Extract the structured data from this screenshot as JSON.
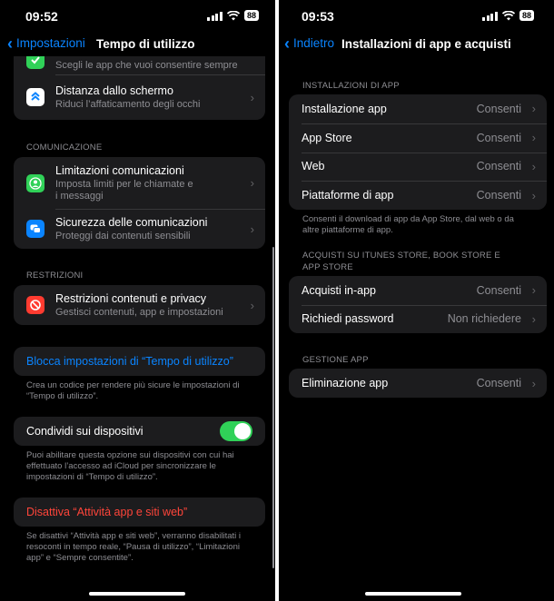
{
  "left": {
    "status": {
      "time": "09:52",
      "battery": "88"
    },
    "nav": {
      "back_label": "Impostazioni",
      "title": "Tempo di utilizzo"
    },
    "partial_row": {
      "sub": "Scegli le app che vuoi consentire sempre"
    },
    "distance": {
      "title": "Distanza dallo schermo",
      "sub": "Riduci l’affaticamento degli occhi"
    },
    "comm_header": "COMUNICAZIONE",
    "comm_limits": {
      "title": "Limitazioni comunicazioni",
      "sub1": "Imposta limiti per le chiamate e",
      "sub2": "i messaggi"
    },
    "comm_safety": {
      "title": "Sicurezza delle comunicazioni",
      "sub": "Proteggi dai contenuti sensibili"
    },
    "restr_header": "RESTRIZIONI",
    "restr": {
      "title": "Restrizioni contenuti e privacy",
      "sub": "Gestisci contenuti, app e impostazioni"
    },
    "lock_settings": "Blocca impostazioni di “Tempo di utilizzo”",
    "lock_note": [
      "Crea un codice per rendere più sicure le impostazioni di",
      "“Tempo di utilizzo”."
    ],
    "share_devices": "Condividi sui dispositivi",
    "share_note": [
      "Puoi abilitare questa opzione sui dispositivi con cui hai",
      "effettuato l’accesso ad iCloud per sincronizzare le",
      "impostazioni di “Tempo di utilizzo”."
    ],
    "disable": "Disattiva “Attività app e siti web”",
    "disable_note": [
      "Se disattivi “Attività app e siti web”, verranno disabilitati i",
      "resoconti in tempo reale, “Pausa di utilizzo”, “Limitazioni",
      "app” e “Sempre consentite”."
    ]
  },
  "right": {
    "status": {
      "time": "09:53",
      "battery": "88"
    },
    "nav": {
      "back_label": "Indietro",
      "title": "Installazioni di app e acquisti"
    },
    "install_header": "INSTALLAZIONI DI APP",
    "install_rows": [
      {
        "label": "Installazione app",
        "value": "Consenti"
      },
      {
        "label": "App Store",
        "value": "Consenti"
      },
      {
        "label": "Web",
        "value": "Consenti"
      },
      {
        "label": "Piattaforme di app",
        "value": "Consenti"
      }
    ],
    "install_note": [
      "Consenti il download di app da App Store, dal web o da",
      "altre piattaforme di app."
    ],
    "purchase_header": [
      "ACQUISTI SU ITUNES STORE, BOOK STORE E",
      "APP STORE"
    ],
    "purchase_rows": [
      {
        "label": "Acquisti in-app",
        "value": "Consenti"
      },
      {
        "label": "Richiedi password",
        "value": "Non richiedere"
      }
    ],
    "manage_header": "GESTIONE APP",
    "manage_rows": [
      {
        "label": "Eliminazione app",
        "value": "Consenti"
      }
    ]
  },
  "colors": {
    "accent": "#0a84ff",
    "destructive": "#ff453a",
    "toggle_on": "#30d158",
    "cell_bg": "#1c1c1e"
  }
}
